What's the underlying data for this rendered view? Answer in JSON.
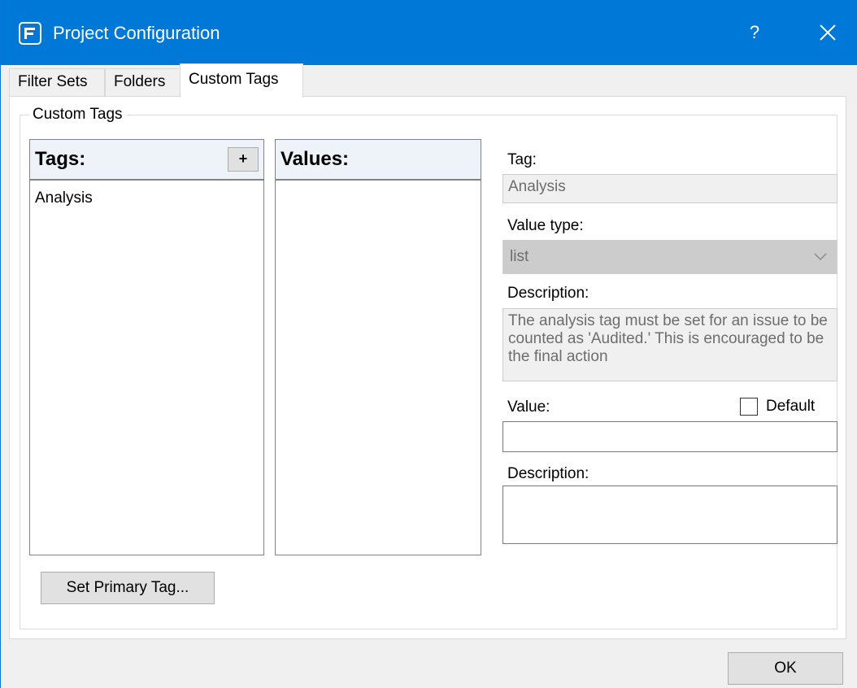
{
  "window": {
    "title": "Project Configuration",
    "help_label": "?",
    "accent_color": "#0078d7"
  },
  "tabs": [
    {
      "label": "Filter Sets"
    },
    {
      "label": "Folders"
    },
    {
      "label": "Custom Tags"
    }
  ],
  "custom_tags": {
    "group_label": "Custom Tags",
    "tags_header": "Tags:",
    "add_label": "+",
    "tags": [
      {
        "label": "Analysis"
      }
    ],
    "values_header": "Values:",
    "values": []
  },
  "details": {
    "tag_label": "Tag:",
    "tag_value": "Analysis",
    "value_type_label": "Value type:",
    "value_type_selected": "list",
    "description_label": "Description:",
    "description_text": "The analysis tag must be set for an issue to be counted as 'Audited.' This is encouraged to be the final action",
    "value_label": "Value:",
    "default_label": "Default",
    "default_checked": false,
    "value_input": "",
    "value_description_label": "Description:",
    "value_description_input": ""
  },
  "buttons": {
    "set_primary_tag": "Set Primary Tag...",
    "ok": "OK"
  }
}
